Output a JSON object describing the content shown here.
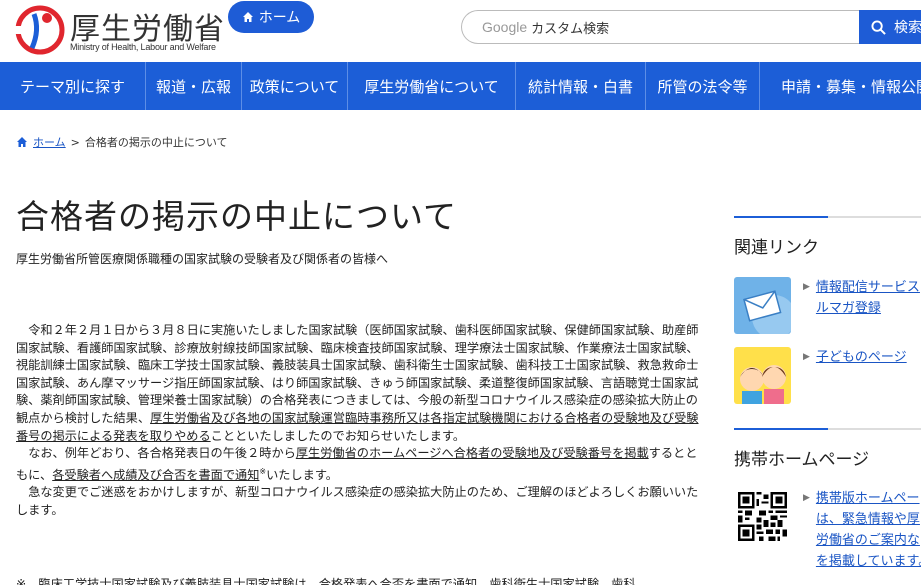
{
  "header": {
    "logo_title": "厚生労働省",
    "logo_subtitle": "Ministry of Health, Labour and Welfare",
    "home_label": "ホーム",
    "search_brand": "Google",
    "search_placeholder": "カスタム検索",
    "search_button": "検索"
  },
  "nav": [
    {
      "label": "テーマ別に探す"
    },
    {
      "label": "報道・広報"
    },
    {
      "label": "政策について"
    },
    {
      "label": "厚生労働省について"
    },
    {
      "label": "統計情報・白書"
    },
    {
      "label": "所管の法令等"
    },
    {
      "label": "申請・募集・情報公開"
    }
  ],
  "breadcrumb": {
    "home": "ホーム",
    "separator": ">",
    "current": "合格者の掲示の中止について"
  },
  "main": {
    "title": "合格者の掲示の中止について",
    "lead": "厚生労働省所管医療関係職種の国家試験の受験者及び関係者の皆様へ",
    "p1_a": "令和２年２月１日から３月８日に実施いたしました国家試験（医師国家試験、歯科医師国家試験、保健師国家試験、助産師国家試験、看護師国家試験、診療放射線技師国家試験、臨床検査技師国家試験、理学療法士国家試験、作業療法士国家試験、視能訓練士国家試験、臨床工学技士国家試験、義肢装具士国家試験、歯科衛生士国家試験、歯科技工士国家試験、救急救命士国家試験、あん摩マッサージ指圧師国家試験、はり師国家試験、きゅう師国家試験、柔道整復師国家試験、言語聴覚士国家試験、薬剤師国家試験、管理栄養士国家試験）の合格発表につきましては、今般の新型コロナウイルス感染症の感染拡大防止の観点から検討した結果、",
    "p1_u": "厚生労働省及び各地の国家試験運営臨時事務所又は各指定試験機関における合格者の受験地及び受験番号の掲示による発表を取りやめる",
    "p1_b": "ことといたしましたのでお知らせいたします。",
    "p2_a": "なお、例年どおり、各合格発表日の午後２時から",
    "p2_u1": "厚生労働省のホームページへ合格者の受験地及び受験番号を掲載",
    "p2_b": "するとともに、",
    "p2_u2": "各受験者へ成績及び合否を書面で通知",
    "p2_sup": "※",
    "p2_c": "いたします。",
    "p3": "急な変更でご迷惑をおかけしますが、新型コロナウイルス感染症の感染拡大防止のため、ご理解のほどよろしくお願いいたします。",
    "note": "※　臨床工学技士国家試験及び義肢装具士国家試験は、合格発表へ合否を書面で通知、歯科衛生士国家試験、歯科"
  },
  "sidebar": {
    "related_heading": "関連リンク",
    "related": [
      {
        "lines": [
          "情報配信サービス",
          "ルマガ登録"
        ],
        "icon": "mail-icon"
      },
      {
        "lines": [
          "子どものページ"
        ],
        "icon": "kids-icon"
      }
    ],
    "mobile_heading": "携帯ホームページ",
    "mobile": {
      "lines": [
        "携帯版ホームペー",
        "は、緊急情報や厚",
        "労働省のご案内な",
        "を掲載しています。"
      ],
      "icon": "qr-code-icon"
    }
  },
  "colors": {
    "brand_blue": "#1c5ed7",
    "link_blue": "#1a55c4",
    "logo_red": "#e0262e"
  }
}
